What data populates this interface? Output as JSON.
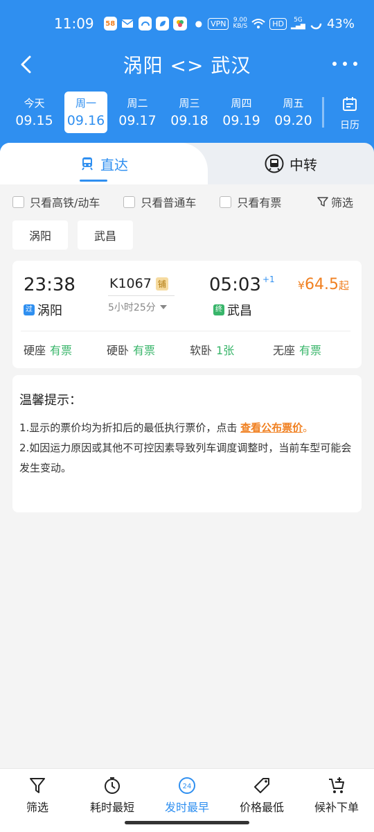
{
  "status_bar": {
    "time": "11:09",
    "app_badge": "58",
    "vpn": "VPN",
    "net_speed_top": "9.00",
    "net_speed_bottom": "KB/S",
    "hd": "HD",
    "signal": "5G",
    "battery": "43%"
  },
  "nav": {
    "title": "涡阳 <> 武汉"
  },
  "dates": [
    {
      "weekday": "今天",
      "date": "09.15"
    },
    {
      "weekday": "周一",
      "date": "09.16"
    },
    {
      "weekday": "周二",
      "date": "09.17"
    },
    {
      "weekday": "周三",
      "date": "09.18"
    },
    {
      "weekday": "周四",
      "date": "09.19"
    },
    {
      "weekday": "周五",
      "date": "09.20"
    }
  ],
  "calendar_label": "日历",
  "tabs": {
    "direct": "直达",
    "transfer": "中转"
  },
  "filters": {
    "high_speed": "只看高铁/动车",
    "regular": "只看普通车",
    "available": "只看有票",
    "filter": "筛选"
  },
  "stations": [
    "涡阳",
    "武昌"
  ],
  "train": {
    "dep_time": "23:38",
    "dep_tag": "过",
    "dep_station": "涡阳",
    "number": "K1067",
    "sleeper_badge": "铺",
    "duration": "5小时25分",
    "arr_time": "05:03",
    "arr_day_offset": "+1",
    "arr_tag": "终",
    "arr_station": "武昌",
    "price_currency": "¥",
    "price": "64.5",
    "price_suffix": "起",
    "seats": [
      {
        "type": "硬座",
        "status": "有票"
      },
      {
        "type": "硬卧",
        "status": "有票"
      },
      {
        "type": "软卧",
        "status": "1张"
      },
      {
        "type": "无座",
        "status": "有票"
      }
    ]
  },
  "notice": {
    "title": "温馨提示：",
    "line1_pre": "1.显示的票价均为折扣后的最低执行票价，点击 ",
    "line1_link": "查看公布票价",
    "line1_post": "。",
    "line2": "2.如因运力原因或其他不可控因素导致列车调度调整时，当前车型可能会发生变动。"
  },
  "bottom_nav": [
    {
      "label": "筛选",
      "icon": "filter-icon"
    },
    {
      "label": "耗时最短",
      "icon": "timer-icon"
    },
    {
      "label": "发时最早",
      "icon": "clock-24-icon",
      "badge": "24"
    },
    {
      "label": "价格最低",
      "icon": "price-tag-icon"
    },
    {
      "label": "候补下单",
      "icon": "cart-plus-icon"
    }
  ],
  "colors": {
    "primary": "#2f8ff0",
    "price": "#f08021",
    "available": "#38b56a"
  }
}
